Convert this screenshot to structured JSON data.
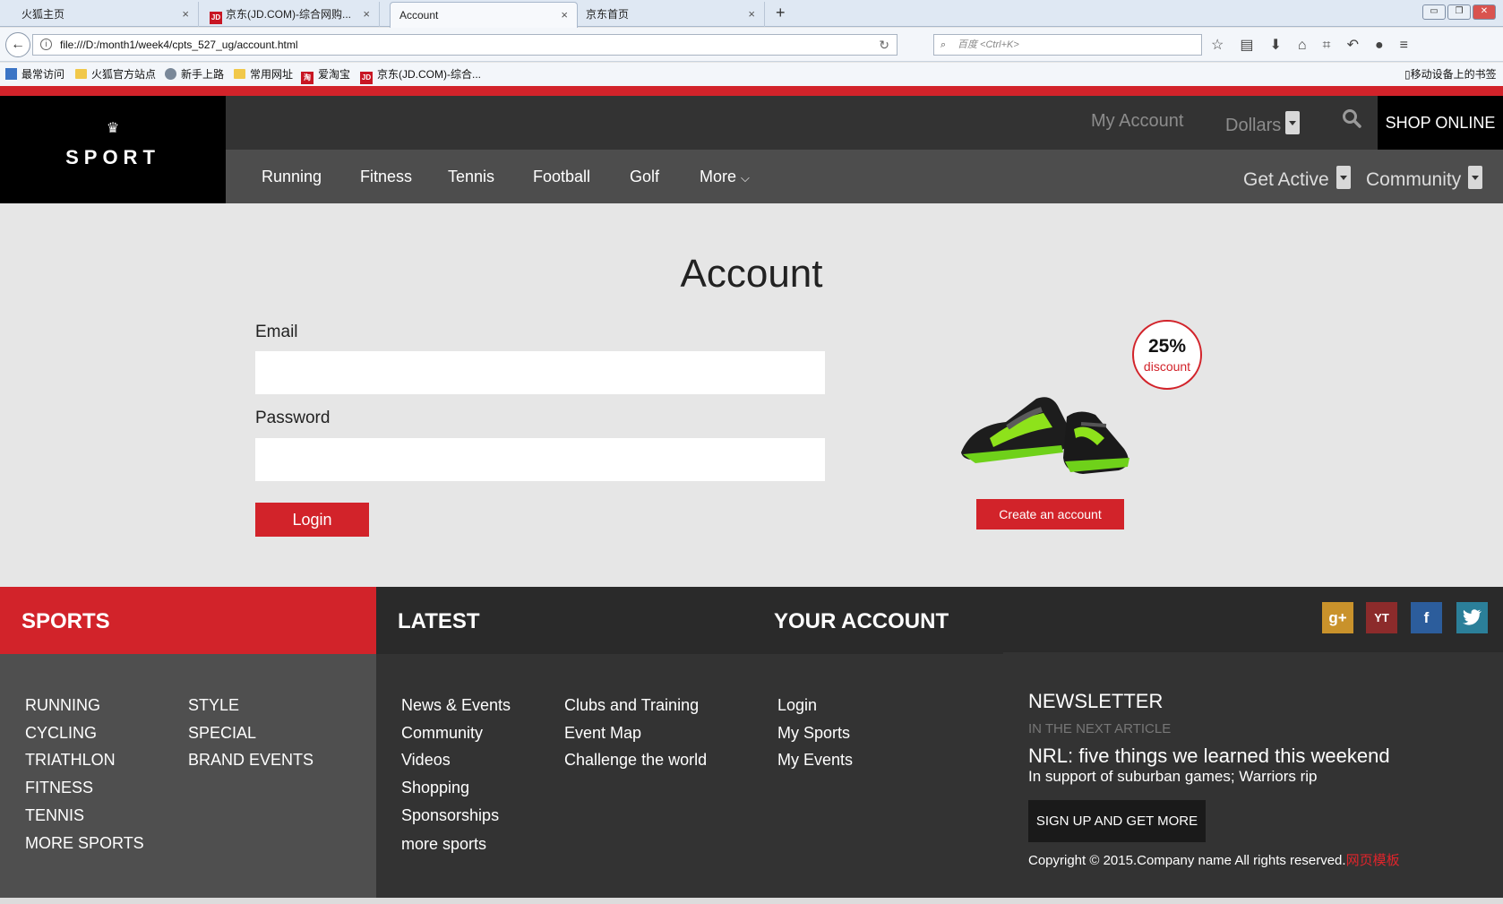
{
  "browser": {
    "tabs": [
      {
        "label": "火狐主页",
        "icon": "none"
      },
      {
        "label": "京东(JD.COM)-综合网购...",
        "icon": "jd-icon"
      },
      {
        "label": "Account",
        "icon": "none"
      },
      {
        "label": "京东首页",
        "icon": "none"
      }
    ],
    "jd_badge": "JD",
    "close_glyph": "×",
    "new_tab_glyph": "+",
    "url": "file:///D:/month1/week4/cpts_527_ug/account.html",
    "search_placeholder": "百度 <Ctrl+K>",
    "bookmarks": [
      {
        "label": "最常访问",
        "icon": "bookmark-icon"
      },
      {
        "label": "火狐官方站点",
        "icon": "folder-icon"
      },
      {
        "label": "新手上路",
        "icon": "globe-icon"
      },
      {
        "label": "常用网址",
        "icon": "folder-icon"
      },
      {
        "label": "爱淘宝",
        "icon": "taobao-icon"
      },
      {
        "label": "京东(JD.COM)-综合...",
        "icon": "jd-icon"
      }
    ],
    "taobao_badge": "淘",
    "mobile_bookmarks": "移动设备上的书签"
  },
  "header": {
    "logo_text": "SPORT",
    "my_account": "My Account",
    "currency": "Dollars",
    "shop_online": "SHOP ONLINE"
  },
  "nav": {
    "items": [
      "Running",
      "Fitness",
      "Tennis",
      "Football",
      "Golf",
      "More"
    ],
    "get_active": "Get Active",
    "community": "Community"
  },
  "main": {
    "title": "Account",
    "email_label": "Email",
    "email_value": "",
    "password_label": "Password",
    "password_value": "",
    "login_button": "Login",
    "promo_percent": "25%",
    "promo_label": "discount",
    "create_account_button": "Create an account"
  },
  "footer": {
    "sports_heading": "SPORTS",
    "latest_heading": "LATEST",
    "account_heading": "YOUR ACCOUNT",
    "sports_col1": [
      "RUNNING",
      "CYCLING",
      "TRIATHLON",
      "FITNESS",
      "TENNIS",
      "MORE SPORTS"
    ],
    "sports_col2": [
      "STYLE",
      "SPECIAL",
      "BRAND EVENTS"
    ],
    "latest_col1": [
      "News & Events",
      "Community",
      "Videos",
      "Shopping",
      "Sponsorships",
      "more sports"
    ],
    "latest_col2": [
      "Clubs and Training",
      "Event Map",
      "Challenge the world"
    ],
    "account_links": [
      "Login",
      "My Sports",
      "My Events"
    ],
    "social": [
      {
        "name": "google-plus",
        "glyph": "g+",
        "color": "#c9922b"
      },
      {
        "name": "youtube",
        "glyph": "YT",
        "color": "#8c2b2b"
      },
      {
        "name": "facebook",
        "glyph": "f",
        "color": "#2c5d9c"
      },
      {
        "name": "twitter",
        "glyph": "✓",
        "color": "#2b7f99"
      }
    ],
    "newsletter_title": "NEWSLETTER",
    "newsletter_sub": "IN THE NEXT ARTICLE",
    "newsletter_headline": "NRL: five things we learned this weekend",
    "newsletter_body": "In support of suburban games; Warriors rip",
    "signup_button": "SIGN UP AND GET MORE",
    "copyright": "Copyright © 2015.Company name All rights reserved.",
    "template_link": "网页模板"
  },
  "colors": {
    "brand_red": "#d2232a",
    "dark": "#333333",
    "nav": "#4d4d4d"
  }
}
